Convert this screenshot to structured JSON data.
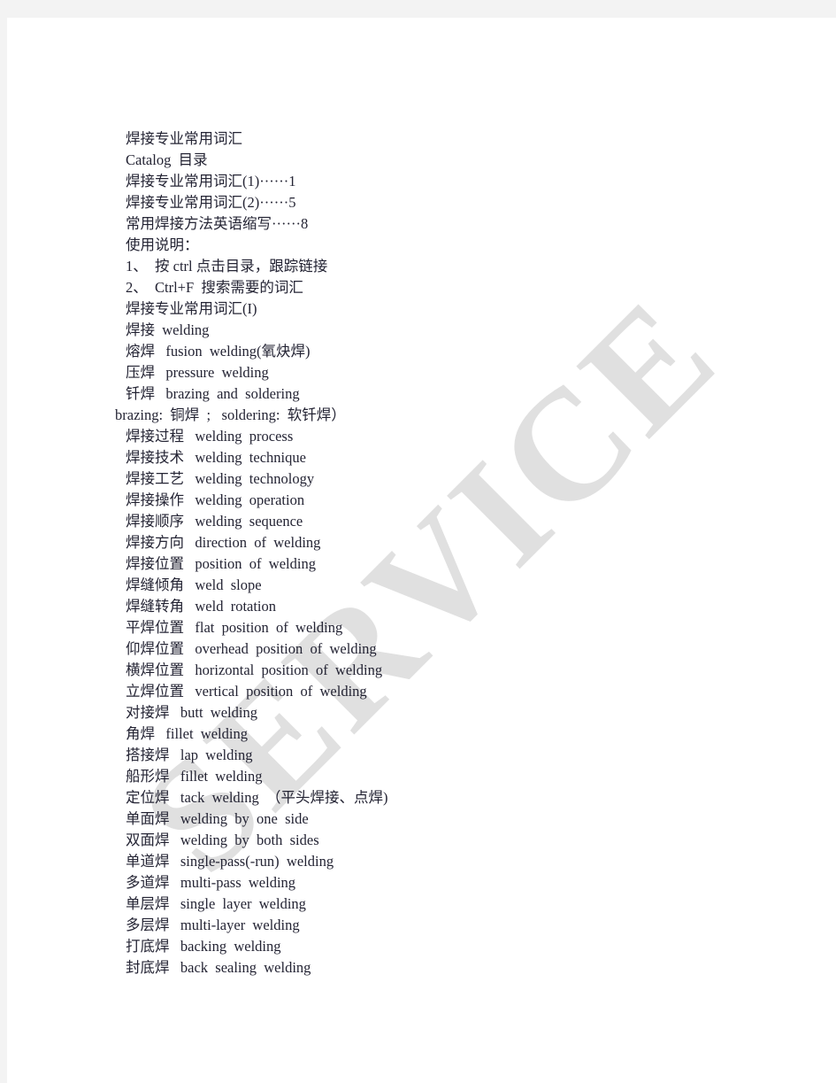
{
  "document": {
    "title": "焊接专业常用词汇",
    "catalog_heading": "Catalog  目录",
    "toc": [
      "焊接专业常用词汇(1)······1",
      "焊接专业常用词汇(2)······5",
      "常用焊接方法英语缩写······8"
    ],
    "usage_heading": "使用说明：",
    "usage_items": [
      "1、\t按 ctrl 点击目录，跟踪链接",
      "2、\tCtrl+F  搜索需要的词汇"
    ],
    "section_heading": "焊接专业常用词汇(I)",
    "entries": [
      "焊接  welding",
      "熔焊   fusion  welding(氧炔焊)",
      "压焊   pressure  welding",
      "钎焊   brazing  and  soldering",
      "brazing:  铜焊  ;   soldering:  软钎焊）",
      "焊接过程   welding  process",
      "焊接技术   welding  technique",
      "焊接工艺   welding  technology",
      "焊接操作   welding  operation",
      "焊接顺序   welding  sequence",
      "焊接方向   direction  of  welding",
      "焊接位置   position  of  welding",
      "焊缝倾角   weld  slope",
      "焊缝转角   weld  rotation",
      "平焊位置   flat  position  of  welding",
      "仰焊位置   overhead  position  of  welding",
      "横焊位置   horizontal  position  of  welding",
      "立焊位置   vertical  position  of  welding",
      "对接焊   butt  welding",
      "角焊   fillet  welding",
      "搭接焊   lap  welding",
      "船形焊   fillet  welding",
      "定位焊   tack  welding  （平头焊接、点焊)",
      "单面焊   welding  by  one  side",
      "双面焊   welding  by  both  sides",
      "单道焊   single-pass(-run)  welding",
      "多道焊   multi-pass  welding",
      "单层焊   single  layer  welding",
      "多层焊   multi-layer  welding",
      "打底焊   backing  welding",
      "封底焊   back  sealing  welding"
    ]
  },
  "watermark": {
    "text": "SERVICE",
    "color": "#e0e0e0"
  },
  "colors": {
    "page_background": "#ffffff",
    "band_gray": "#f3f3f3",
    "body_text": "#242434"
  }
}
